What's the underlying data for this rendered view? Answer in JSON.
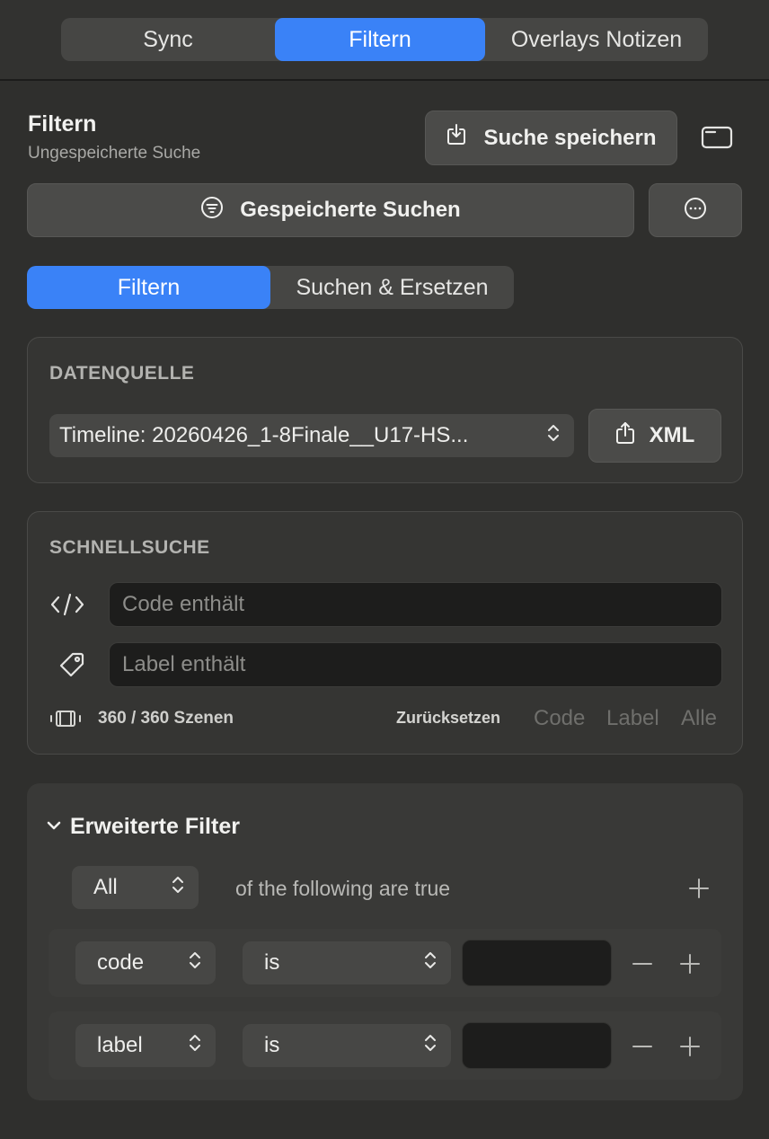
{
  "top_tabs": [
    "Sync",
    "Filtern",
    "Overlays Notizen"
  ],
  "header": {
    "title": "Filtern",
    "subtitle": "Ungespeicherte Suche",
    "save_label": "Suche speichern",
    "saved_searches_label": "Gespeicherte Suchen"
  },
  "sub_tabs": [
    "Filtern",
    "Suchen & Ersetzen"
  ],
  "datasource": {
    "section_label": "DATENQUELLE",
    "timeline_value": "Timeline: 20260426_1-8Finale__U17-HS...",
    "xml_label": "XML"
  },
  "quicksearch": {
    "section_label": "SCHNELLSUCHE",
    "code_placeholder": "Code enthält",
    "label_placeholder": "Label enthält",
    "count": "360 / 360 Szenen",
    "reset_label": "Zurücksetzen",
    "code_link": "Code",
    "label_link": "Label",
    "all_link": "Alle"
  },
  "advanced": {
    "title": "Erweiterte Filter",
    "match_value": "All",
    "match_text": "of the following are true",
    "rules": [
      {
        "field": "code",
        "operator": "is",
        "value": ""
      },
      {
        "field": "label",
        "operator": "is",
        "value": ""
      }
    ]
  },
  "colors": {
    "accent": "#3a82f7",
    "background": "#2f2f2d"
  }
}
